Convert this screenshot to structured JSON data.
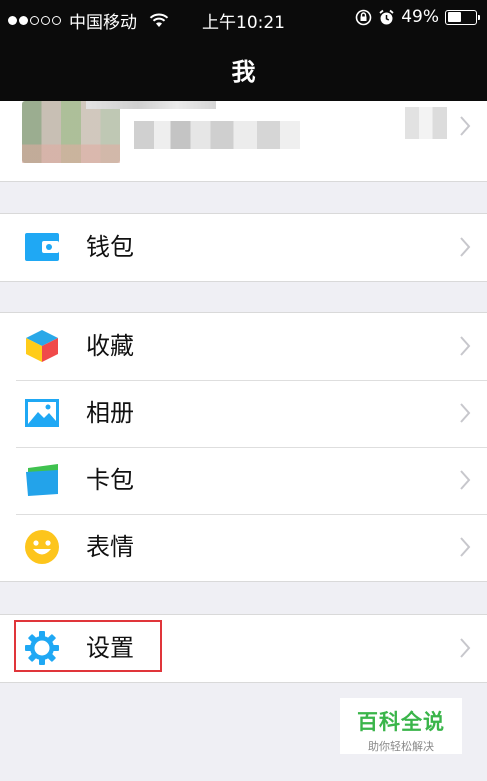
{
  "status_bar": {
    "carrier": "中国移动",
    "time": "上午10:21",
    "battery": "49%",
    "battery_level": 0.49,
    "signal_bars_filled": 2,
    "signal_bars_total": 5
  },
  "nav": {
    "title": "我"
  },
  "groups": {
    "wallet": {
      "label": "钱包",
      "icon": "wallet-icon"
    },
    "favorites": {
      "label": "收藏",
      "icon": "favorites-cube-icon"
    },
    "album": {
      "label": "相册",
      "icon": "photo-album-icon"
    },
    "cards": {
      "label": "卡包",
      "icon": "card-pack-icon"
    },
    "stickers": {
      "label": "表情",
      "icon": "smiley-icon"
    },
    "settings": {
      "label": "设置",
      "icon": "gear-icon"
    }
  },
  "watermark": {
    "title": "百科全说",
    "subtitle": "助你轻松解决"
  },
  "colors": {
    "nav_background": "#0b0b0b",
    "page_background": "#efeff4",
    "icon_blue": "#1fa8f4",
    "highlight_red": "#e0353a",
    "watermark_green": "#3ab54a"
  }
}
